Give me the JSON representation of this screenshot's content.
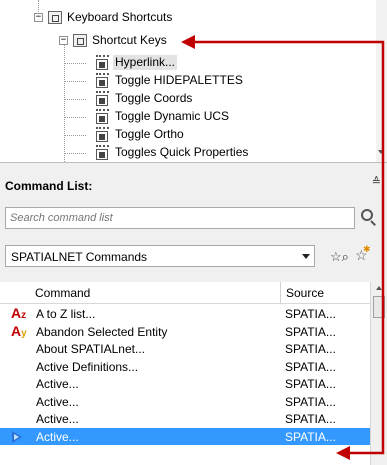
{
  "tree": {
    "root": {
      "label": "Keyboard Shortcuts",
      "expander": "−"
    },
    "child": {
      "label": "Shortcut Keys",
      "expander": "−"
    },
    "items": [
      {
        "label": "Hyperlink..."
      },
      {
        "label": "Toggle HIDEPALETTES"
      },
      {
        "label": "Toggle Coords"
      },
      {
        "label": "Toggle Dynamic UCS"
      },
      {
        "label": "Toggle Ortho"
      },
      {
        "label": "Toggles Quick Properties"
      }
    ]
  },
  "command_list": {
    "title": "Command List:",
    "search_placeholder": "Search command list",
    "filter_value": "SPATIALNET Commands",
    "columns": {
      "command": "Command",
      "source": "Source"
    },
    "rows": [
      {
        "command": "A to Z list...",
        "source": "SPATIA...",
        "icon": "a-to-z-icon"
      },
      {
        "command": "Abandon Selected Entity",
        "source": "SPATIA...",
        "icon": "abandon-icon"
      },
      {
        "command": "About SPATIALnet...",
        "source": "SPATIA...",
        "icon": ""
      },
      {
        "command": "Active Definitions...",
        "source": "SPATIA...",
        "icon": ""
      },
      {
        "command": "Active...",
        "source": "SPATIA...",
        "icon": ""
      },
      {
        "command": "Active...",
        "source": "SPATIA...",
        "icon": ""
      },
      {
        "command": "Active...",
        "source": "SPATIA...",
        "icon": ""
      },
      {
        "command": "Active...",
        "source": "SPATIA...",
        "icon": "play-icon",
        "selected": true
      }
    ]
  },
  "colors": {
    "annotation": "#c00000",
    "selection": "#3399ff",
    "panel_bg": "#f0f0f0"
  }
}
